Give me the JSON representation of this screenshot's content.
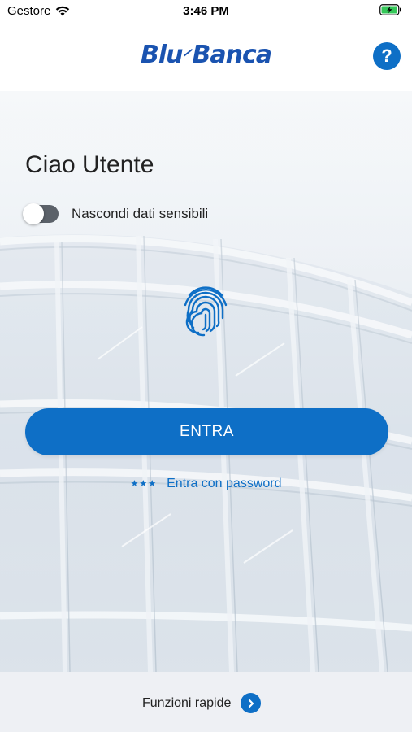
{
  "status_bar": {
    "carrier": "Gestore",
    "time": "3:46 PM"
  },
  "header": {
    "logo_part1": "Blu",
    "logo_part2": "Banca",
    "help_label": "?"
  },
  "main": {
    "greeting": "Ciao Utente",
    "toggle_label": "Nascondi dati sensibili",
    "toggle_on": false,
    "enter_button": "ENTRA",
    "password_link_stars": "★★★",
    "password_link": "Entra con password"
  },
  "bottom_bar": {
    "quick_functions": "Funzioni rapide"
  },
  "colors": {
    "brand_blue": "#0e6fc6",
    "logo_blue": "#1a53b0",
    "toggle_track": "#5b6169"
  }
}
